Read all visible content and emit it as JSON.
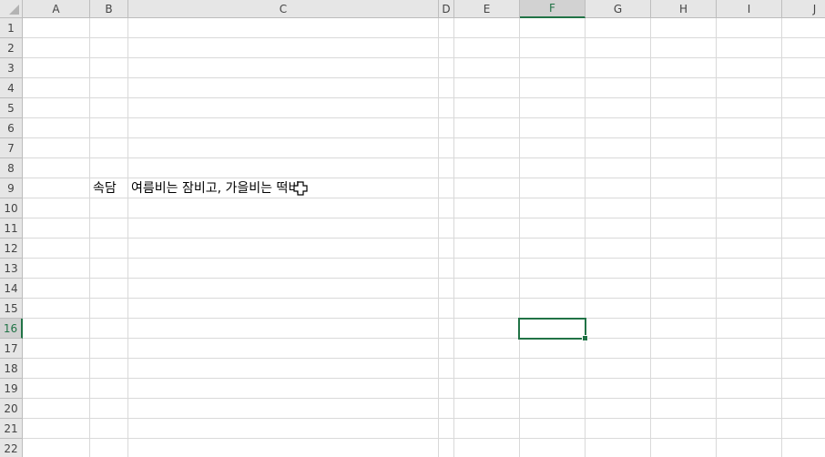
{
  "columns": [
    "A",
    "B",
    "C",
    "D",
    "E",
    "F",
    "G",
    "H",
    "I",
    "J"
  ],
  "rows": [
    "1",
    "2",
    "3",
    "4",
    "5",
    "6",
    "7",
    "8",
    "9",
    "10",
    "11",
    "12",
    "13",
    "14",
    "15",
    "16",
    "17",
    "18",
    "19",
    "20",
    "21",
    "22"
  ],
  "active_column": "F",
  "active_row": "16",
  "cells": {
    "B9": "속담",
    "C9": "여름비는 잠비고, 가을비는 떡비"
  },
  "colors": {
    "selection": "#217346",
    "gridline": "#d9d9d9",
    "header_bg": "#e6e6e6"
  },
  "cursor_icon": "cell-select-cross-icon"
}
